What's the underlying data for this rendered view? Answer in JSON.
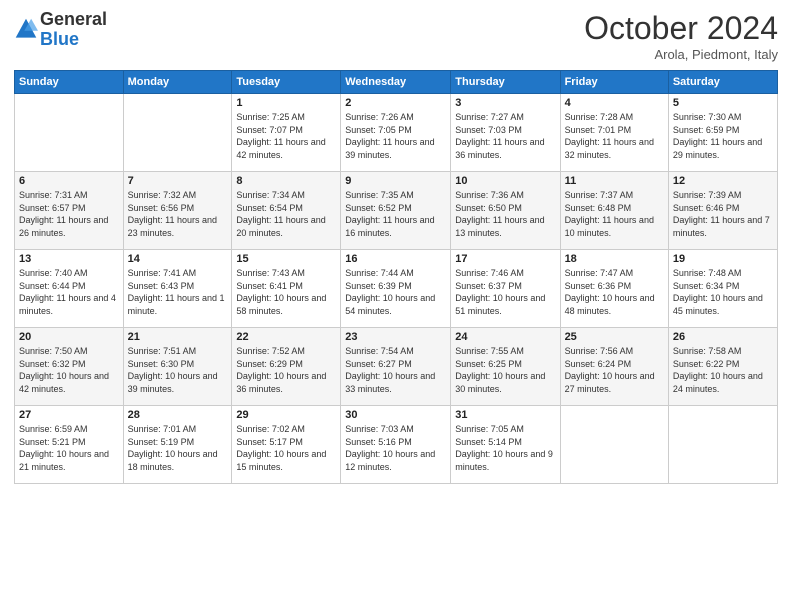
{
  "header": {
    "logo_general": "General",
    "logo_blue": "Blue",
    "month_title": "October 2024",
    "subtitle": "Arola, Piedmont, Italy"
  },
  "days_of_week": [
    "Sunday",
    "Monday",
    "Tuesday",
    "Wednesday",
    "Thursday",
    "Friday",
    "Saturday"
  ],
  "weeks": [
    [
      {
        "day": "",
        "info": ""
      },
      {
        "day": "",
        "info": ""
      },
      {
        "day": "1",
        "info": "Sunrise: 7:25 AM\nSunset: 7:07 PM\nDaylight: 11 hours and 42 minutes."
      },
      {
        "day": "2",
        "info": "Sunrise: 7:26 AM\nSunset: 7:05 PM\nDaylight: 11 hours and 39 minutes."
      },
      {
        "day": "3",
        "info": "Sunrise: 7:27 AM\nSunset: 7:03 PM\nDaylight: 11 hours and 36 minutes."
      },
      {
        "day": "4",
        "info": "Sunrise: 7:28 AM\nSunset: 7:01 PM\nDaylight: 11 hours and 32 minutes."
      },
      {
        "day": "5",
        "info": "Sunrise: 7:30 AM\nSunset: 6:59 PM\nDaylight: 11 hours and 29 minutes."
      }
    ],
    [
      {
        "day": "6",
        "info": "Sunrise: 7:31 AM\nSunset: 6:57 PM\nDaylight: 11 hours and 26 minutes."
      },
      {
        "day": "7",
        "info": "Sunrise: 7:32 AM\nSunset: 6:56 PM\nDaylight: 11 hours and 23 minutes."
      },
      {
        "day": "8",
        "info": "Sunrise: 7:34 AM\nSunset: 6:54 PM\nDaylight: 11 hours and 20 minutes."
      },
      {
        "day": "9",
        "info": "Sunrise: 7:35 AM\nSunset: 6:52 PM\nDaylight: 11 hours and 16 minutes."
      },
      {
        "day": "10",
        "info": "Sunrise: 7:36 AM\nSunset: 6:50 PM\nDaylight: 11 hours and 13 minutes."
      },
      {
        "day": "11",
        "info": "Sunrise: 7:37 AM\nSunset: 6:48 PM\nDaylight: 11 hours and 10 minutes."
      },
      {
        "day": "12",
        "info": "Sunrise: 7:39 AM\nSunset: 6:46 PM\nDaylight: 11 hours and 7 minutes."
      }
    ],
    [
      {
        "day": "13",
        "info": "Sunrise: 7:40 AM\nSunset: 6:44 PM\nDaylight: 11 hours and 4 minutes."
      },
      {
        "day": "14",
        "info": "Sunrise: 7:41 AM\nSunset: 6:43 PM\nDaylight: 11 hours and 1 minute."
      },
      {
        "day": "15",
        "info": "Sunrise: 7:43 AM\nSunset: 6:41 PM\nDaylight: 10 hours and 58 minutes."
      },
      {
        "day": "16",
        "info": "Sunrise: 7:44 AM\nSunset: 6:39 PM\nDaylight: 10 hours and 54 minutes."
      },
      {
        "day": "17",
        "info": "Sunrise: 7:46 AM\nSunset: 6:37 PM\nDaylight: 10 hours and 51 minutes."
      },
      {
        "day": "18",
        "info": "Sunrise: 7:47 AM\nSunset: 6:36 PM\nDaylight: 10 hours and 48 minutes."
      },
      {
        "day": "19",
        "info": "Sunrise: 7:48 AM\nSunset: 6:34 PM\nDaylight: 10 hours and 45 minutes."
      }
    ],
    [
      {
        "day": "20",
        "info": "Sunrise: 7:50 AM\nSunset: 6:32 PM\nDaylight: 10 hours and 42 minutes."
      },
      {
        "day": "21",
        "info": "Sunrise: 7:51 AM\nSunset: 6:30 PM\nDaylight: 10 hours and 39 minutes."
      },
      {
        "day": "22",
        "info": "Sunrise: 7:52 AM\nSunset: 6:29 PM\nDaylight: 10 hours and 36 minutes."
      },
      {
        "day": "23",
        "info": "Sunrise: 7:54 AM\nSunset: 6:27 PM\nDaylight: 10 hours and 33 minutes."
      },
      {
        "day": "24",
        "info": "Sunrise: 7:55 AM\nSunset: 6:25 PM\nDaylight: 10 hours and 30 minutes."
      },
      {
        "day": "25",
        "info": "Sunrise: 7:56 AM\nSunset: 6:24 PM\nDaylight: 10 hours and 27 minutes."
      },
      {
        "day": "26",
        "info": "Sunrise: 7:58 AM\nSunset: 6:22 PM\nDaylight: 10 hours and 24 minutes."
      }
    ],
    [
      {
        "day": "27",
        "info": "Sunrise: 6:59 AM\nSunset: 5:21 PM\nDaylight: 10 hours and 21 minutes."
      },
      {
        "day": "28",
        "info": "Sunrise: 7:01 AM\nSunset: 5:19 PM\nDaylight: 10 hours and 18 minutes."
      },
      {
        "day": "29",
        "info": "Sunrise: 7:02 AM\nSunset: 5:17 PM\nDaylight: 10 hours and 15 minutes."
      },
      {
        "day": "30",
        "info": "Sunrise: 7:03 AM\nSunset: 5:16 PM\nDaylight: 10 hours and 12 minutes."
      },
      {
        "day": "31",
        "info": "Sunrise: 7:05 AM\nSunset: 5:14 PM\nDaylight: 10 hours and 9 minutes."
      },
      {
        "day": "",
        "info": ""
      },
      {
        "day": "",
        "info": ""
      }
    ]
  ]
}
